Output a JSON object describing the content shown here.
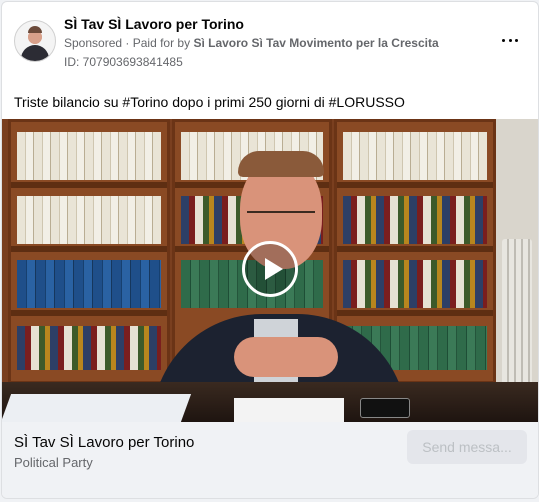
{
  "post": {
    "page_name": "SÌ Tav SÌ Lavoro per Torino",
    "sponsored_label": "Sponsored",
    "separator": "·",
    "paid_for_prefix": "Paid for by",
    "paid_for_by": "Sì Lavoro Sì Tav Movimento per la Crescita",
    "ad_id": "ID: 707903693841485",
    "more_icon": "more-horizontal-icon",
    "caption": "Triste bilancio su #Torino dopo i primi 250 giorni di #LORUSSO"
  },
  "media": {
    "type": "video",
    "play_icon": "play-icon"
  },
  "footer": {
    "page_name": "SÌ Tav SÌ Lavoro per Torino",
    "category": "Political Party",
    "button_label": "Send messa..."
  },
  "colors": {
    "card_bg": "#ffffff",
    "footer_bg": "#f0f2f5",
    "secondary_text": "#65676b",
    "button_bg": "#e4e6eb",
    "button_text": "#bcc0c4"
  }
}
